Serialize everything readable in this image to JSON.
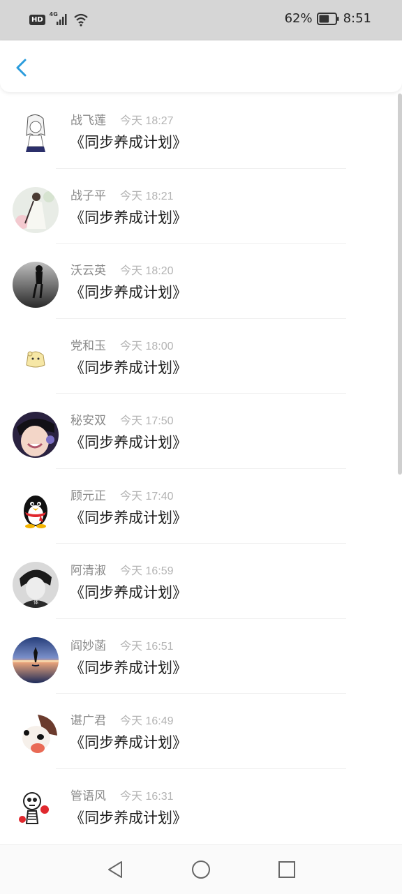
{
  "status_bar": {
    "hd_label": "HD",
    "network_label": "4G",
    "battery_percent": "62%",
    "battery_level": 0.62,
    "time": "8:51"
  },
  "header": {
    "back_icon": "chevron-left-icon",
    "accent_color": "#2b9cdc"
  },
  "messages": [
    {
      "name": "战飞莲",
      "time": "今天 18:27",
      "text": "《同步养成计划》",
      "avatar": "anime-girl"
    },
    {
      "name": "战子平",
      "time": "今天 18:21",
      "text": "《同步养成计划》",
      "avatar": "woman-white-dress"
    },
    {
      "name": "沃云英",
      "time": "今天 18:20",
      "text": "《同步养成计划》",
      "avatar": "man-black-white"
    },
    {
      "name": "党和玉",
      "time": "今天 18:00",
      "text": "《同步养成计划》",
      "avatar": "cartoon-hamster"
    },
    {
      "name": "秘安双",
      "time": "今天 17:50",
      "text": "《同步养成计划》",
      "avatar": "smiling-boy"
    },
    {
      "name": "顾元正",
      "time": "今天 17:40",
      "text": "《同步养成计划》",
      "avatar": "qq-penguin"
    },
    {
      "name": "阿清淑",
      "time": "今天 16:59",
      "text": "《同步养成计划》",
      "avatar": "boy-black-white"
    },
    {
      "name": "阎妙菡",
      "time": "今天 16:51",
      "text": "《同步养成计划》",
      "avatar": "sunset-lake"
    },
    {
      "name": "谌广君",
      "time": "今天 16:49",
      "text": "《同步养成计划》",
      "avatar": "cartoon-dog"
    },
    {
      "name": "管语风",
      "time": "今天 16:31",
      "text": "《同步养成计划》",
      "avatar": "skeleton-boxer"
    }
  ],
  "nav_bar": {
    "back_icon": "triangle-back-icon",
    "home_icon": "circle-home-icon",
    "recents_icon": "square-recents-icon"
  }
}
